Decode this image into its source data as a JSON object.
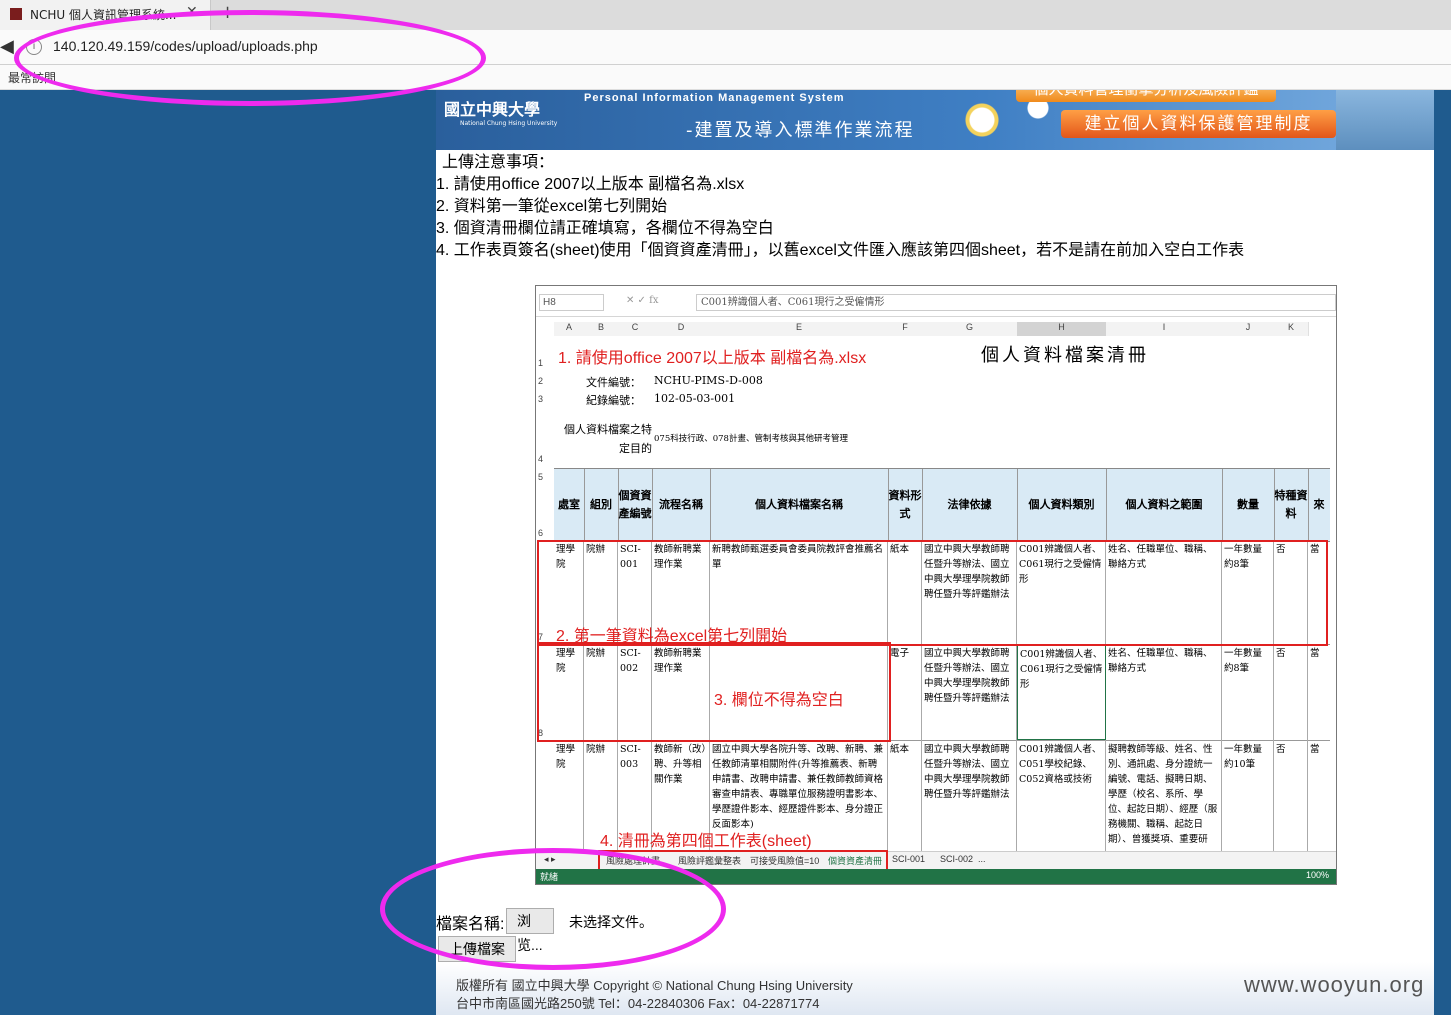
{
  "browser": {
    "tab_title": "NCHU 個人資訊管理系統...",
    "url": "140.120.49.159/codes/upload/uploads.php",
    "bookmarks_label": "最常訪問"
  },
  "banner": {
    "logo": "國立中興大學",
    "logo_sub": "National Chung Hsing University",
    "system_name": "Personal Information Management System",
    "process": "-建置及導入標準作業流程",
    "top_button": "個人資料管理衝擊分析及風險評鑑",
    "main_button": "建立個人資料保護管理制度"
  },
  "notes": {
    "heading": "上傳注意事項：",
    "items": [
      "1. 請使用office 2007以上版本 副檔名為.xlsx",
      "2. 資料第一筆從excel第七列開始",
      "3. 個資清冊欄位請正確填寫，各欄位不得為空白",
      "4. 工作表頁簽名(sheet)使用「個資資產清冊」，以舊excel文件匯入應該第四個sheet，若不是請在前加入空白工作表"
    ]
  },
  "excel": {
    "namebox": "H8",
    "formula": "C001辨識個人者、C061現行之受僱情形",
    "columns": [
      "A",
      "B",
      "C",
      "D",
      "E",
      "F",
      "G",
      "H",
      "I",
      "J",
      "K"
    ],
    "title": "個人資料檔案清冊",
    "doc_no_label": "文件編號：",
    "doc_no": "NCHU-PIMS-D-008",
    "rec_no_label": "紀錄編號：",
    "rec_no": "102-05-03-001",
    "purpose_label": "個人資料檔案之特定目的",
    "purpose": "075科技行政、078計畫、管制考核與其他研考管理",
    "headers": [
      "處室",
      "組別",
      "個資資產編號",
      "流程名稱",
      "個人資料檔案名稱",
      "資料形式",
      "法律依據",
      "個人資料類別",
      "個人資料之範圍",
      "數量",
      "特種資料",
      "來"
    ],
    "rows": [
      [
        "理學院",
        "院辦",
        "SCI-001",
        "教師新聘業理作業",
        "新聘教師甄選委員會委員院教評會推薦名單",
        "紙本",
        "國立中興大學教師聘任暨升等辦法、國立中興大學理學院教師聘任暨升等評鑑辦法",
        "C001辨識個人者、C061現行之受僱情形",
        "姓名、任職單位、職稱、聯絡方式",
        "一年數量約8筆",
        "否",
        "當"
      ],
      [
        "理學院",
        "院辦",
        "SCI-002",
        "教師新聘業理作業",
        "",
        "電子",
        "國立中興大學教師聘任暨升等辦法、國立中興大學理學院教師聘任暨升等評鑑辦法",
        "C001辨識個人者、C061現行之受僱情形",
        "姓名、任職單位、職稱、聯絡方式",
        "一年數量約8筆",
        "否",
        "當"
      ],
      [
        "理學院",
        "院辦",
        "SCI-003",
        "教師新（改）聘、升等相關作業",
        "國立中興大學各院升等、改聘、新聘、兼任教師清單相關附件(升等推薦表、新聘申請書、改聘申請書、兼任教師教師資格審查申請表、專職單位服務證明書影本、學歷證件影本、經歷證件影本、身分證正反面影本)",
        "紙本",
        "國立中興大學教師聘任暨升等辦法、國立中興大學理學院教師聘任暨升等評鑑辦法",
        "C001辨識個人者、C051學校紀錄、C052資格或技術",
        "擬聘教師等級、姓名、性別、通訊處、身分證統一編號、電話、擬聘日期、學歷（校名、系所、學位、起訖日期）、經歷（服務機關、職稱、起訖日期）、曾獲獎項、重要研",
        "一年數量約10筆",
        "否",
        "當"
      ]
    ],
    "annotations": {
      "a1": "1. 請使用office 2007以上版本 副檔名為.xlsx",
      "a2": "2. 第一筆資料為excel第七列開始",
      "a3": "3. 欄位不得為空白",
      "a4": "4. 清冊為第四個工作表(sheet)"
    },
    "sheet_tabs": [
      "風險處理計畫",
      "風險評鑑彙整表",
      "可接受風險值=10",
      "個資資產清冊",
      "SCI-001",
      "SCI-002",
      "..."
    ],
    "status": "就緒",
    "zoom": "100%"
  },
  "upload": {
    "label": "檔案名稱:",
    "browse": "浏览...",
    "no_file": "未选择文件。",
    "submit": "上傳檔案"
  },
  "footer": {
    "line1": "版權所有 國立中興大學    Copyright © National Chung Hsing University",
    "line2": "台中市南區國光路250號    Tel：04-22840306    Fax：04-22871774"
  },
  "watermark": "www.wooyun.org",
  "colors": {
    "side_bg": "#1f5b8e",
    "marker": "#ee2aee",
    "annotation": "#e02020"
  }
}
